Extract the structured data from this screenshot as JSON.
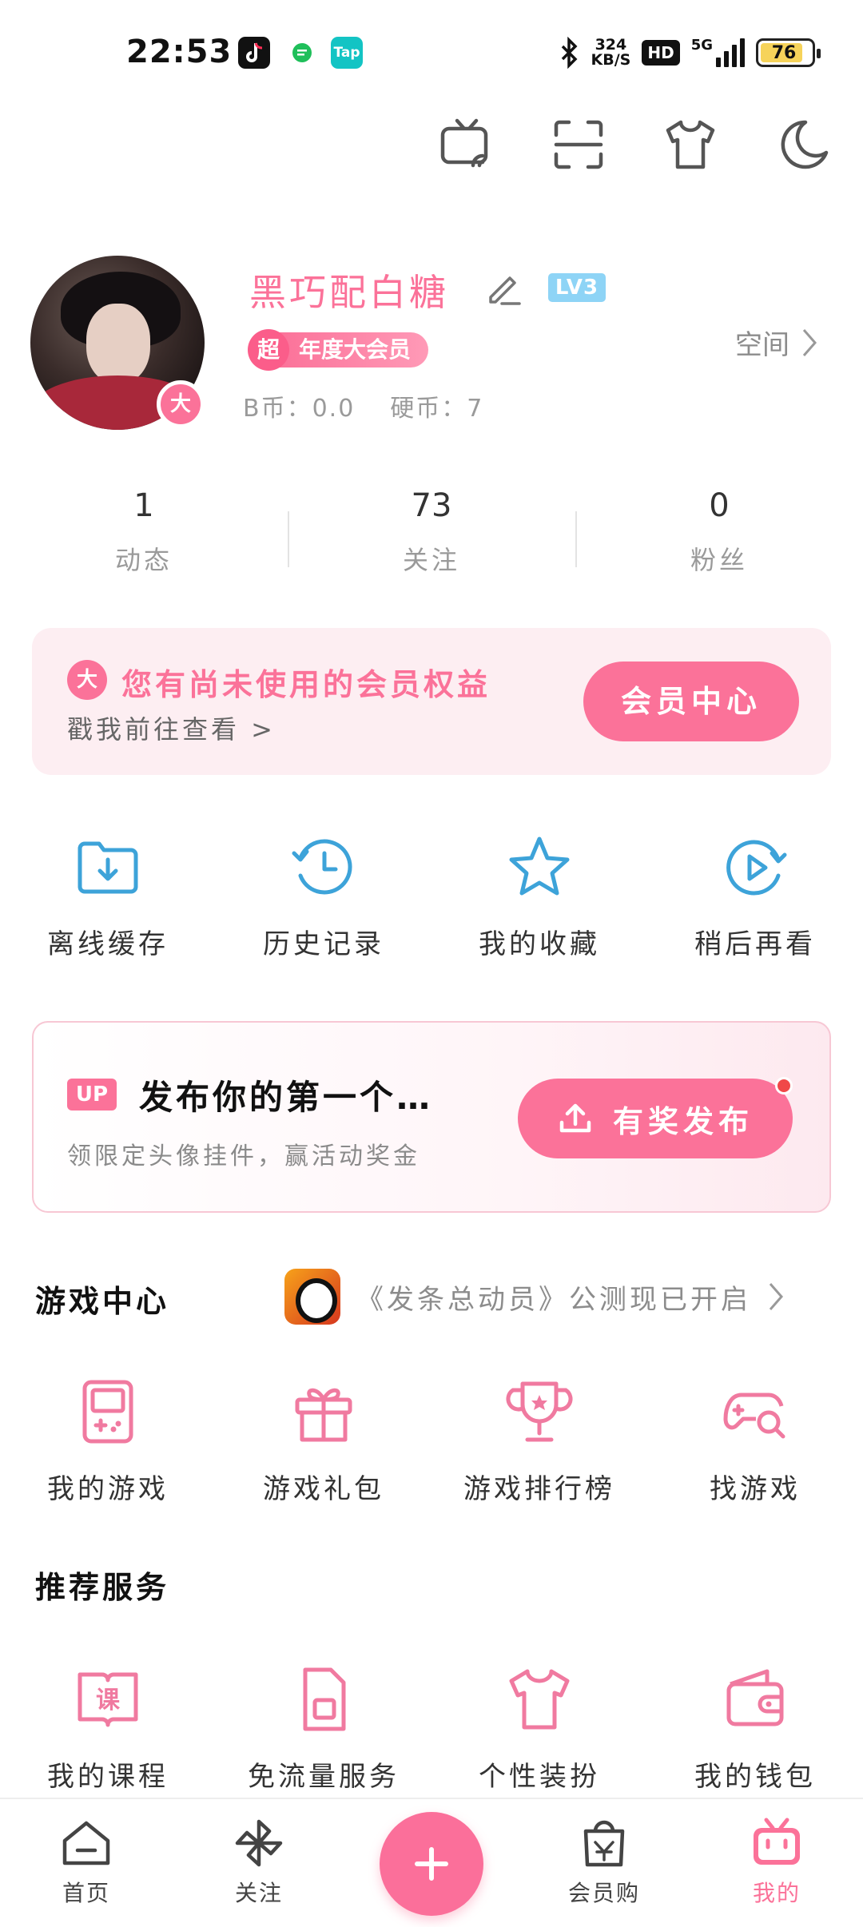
{
  "status_bar": {
    "time": "22:53",
    "network_speed_value": "324",
    "network_speed_unit": "KB/S",
    "hd_label": "HD",
    "network_type": "5G",
    "battery": "76",
    "app_icons": [
      "tiktok-icon",
      "chat-icon",
      "tap-icon"
    ],
    "tap_label": "Tap"
  },
  "toolbar": {
    "icons": [
      "tv-cast-icon",
      "scan-icon",
      "shirt-icon",
      "moon-icon"
    ]
  },
  "profile": {
    "username": "黑巧配白糖",
    "level": "LV3",
    "vip_badge_char": "超",
    "vip_label": "年度大会员",
    "avatar_badge": "大",
    "b_coin": "B币：0.0",
    "hard_coin": "硬币：7",
    "space_link": "空间"
  },
  "stats": [
    {
      "value": "1",
      "label": "动态"
    },
    {
      "value": "73",
      "label": "关注"
    },
    {
      "value": "0",
      "label": "粉丝"
    }
  ],
  "vip_banner": {
    "mark": "大",
    "title": "您有尚未使用的会员权益",
    "subtitle": "戳我前往查看 >",
    "button": "会员中心"
  },
  "quick_actions": [
    {
      "label": "离线缓存",
      "icon": "download-folder-icon"
    },
    {
      "label": "历史记录",
      "icon": "history-clock-icon"
    },
    {
      "label": "我的收藏",
      "icon": "star-icon"
    },
    {
      "label": "稍后再看",
      "icon": "watch-later-icon"
    }
  ],
  "up_banner": {
    "tag": "UP",
    "title": "发布你的第一个…",
    "subtitle": "领限定头像挂件，赢活动奖金",
    "button": "有奖发布"
  },
  "game_center": {
    "title": "游戏中心",
    "promo": "《发条总动员》公测现已开启",
    "items": [
      {
        "label": "我的游戏",
        "icon": "gameboy-icon"
      },
      {
        "label": "游戏礼包",
        "icon": "gift-icon"
      },
      {
        "label": "游戏排行榜",
        "icon": "trophy-icon"
      },
      {
        "label": "找游戏",
        "icon": "gamepad-search-icon"
      }
    ]
  },
  "services": {
    "title": "推荐服务",
    "items": [
      {
        "label": "我的课程",
        "icon": "course-book-icon",
        "glyph": "课"
      },
      {
        "label": "免流量服务",
        "icon": "sim-card-icon"
      },
      {
        "label": "个性装扮",
        "icon": "shirt-icon"
      },
      {
        "label": "我的钱包",
        "icon": "wallet-icon"
      }
    ]
  },
  "bottom_nav": [
    {
      "label": "首页",
      "icon": "home-icon"
    },
    {
      "label": "关注",
      "icon": "pinwheel-icon"
    },
    {
      "label": "",
      "icon": "plus-icon"
    },
    {
      "label": "会员购",
      "icon": "shopping-bag-icon"
    },
    {
      "label": "我的",
      "icon": "tv-face-icon"
    }
  ],
  "colors": {
    "accent": "#fb7299",
    "blue_icon": "#3da3d9",
    "pink_icon": "#f07aa0",
    "banner_bg": "#fdeef2"
  }
}
